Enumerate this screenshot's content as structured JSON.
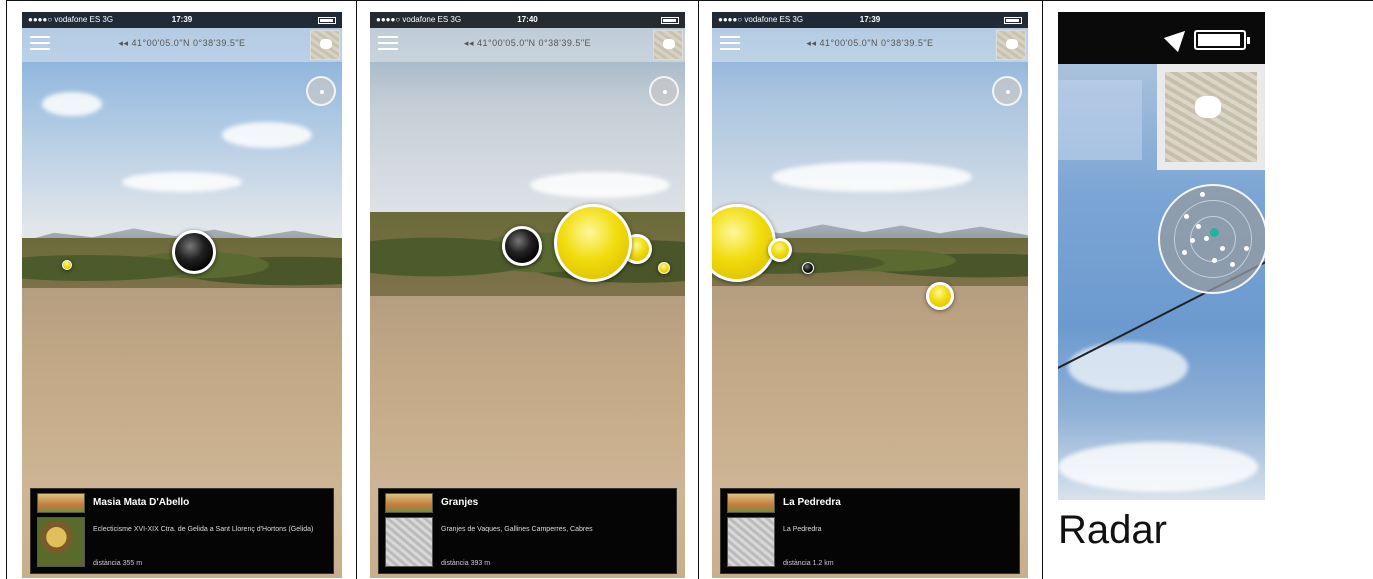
{
  "screens": [
    {
      "status": {
        "carrier": "●●●●○ vodafone ES  3G",
        "time": "17:39"
      },
      "coords": "◂◂ 41°00'05.0\"N 0°38'39.5\"E",
      "card": {
        "title": "Masia Mata D'Abello",
        "description": "Eclecticisme XVI-XIX    Ctra. de Gelida a Sant Llorenç d'Hortons (Gelida)",
        "distance": "distància 355 m"
      }
    },
    {
      "status": {
        "carrier": "●●●●○ vodafone ES  3G",
        "time": "17:40"
      },
      "coords": "◂◂ 41°00'05.0\"N 0°38'39.5\"E",
      "card": {
        "title": "Granjes",
        "description": "Granjes de Vaques, Gallines Camperres, Cabres",
        "distance": "distància 393 m"
      }
    },
    {
      "status": {
        "carrier": "●●●●○ vodafone ES  3G",
        "time": "17:39"
      },
      "coords": "◂◂ 41°00'05.0\"N 0°38'39.5\"E",
      "card": {
        "title": "La Pedredra",
        "description": "La Pedredra",
        "distance": "distància 1.2 km"
      }
    }
  ],
  "radar_panel": {
    "caption": "Radar",
    "icons": [
      "location-arrow-icon",
      "battery-icon",
      "map-thumbnail-icon",
      "radar-icon"
    ]
  },
  "colors": {
    "poi_yellow": "#f1dc0d",
    "poi_black": "#000000",
    "radar_center": "#1fb3a0",
    "card_bg": "#050505"
  }
}
